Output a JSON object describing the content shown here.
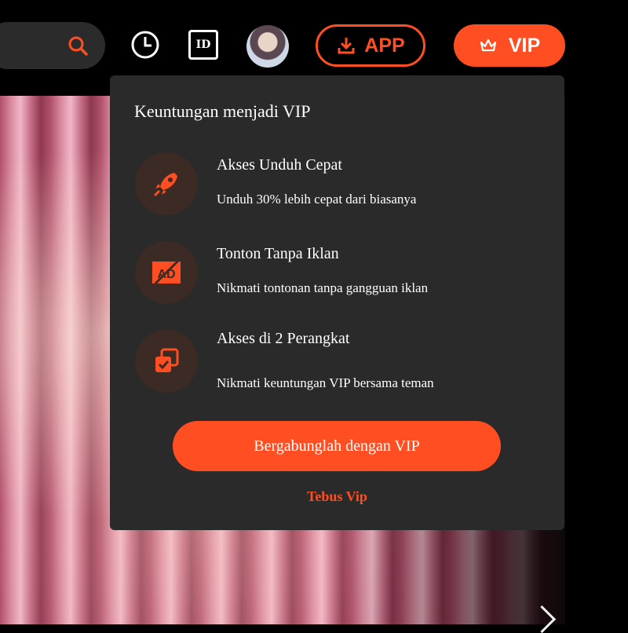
{
  "header": {
    "app_label": "APP",
    "vip_label": "VIP",
    "id_label": "ID",
    "icons": {
      "search": "search-icon",
      "history": "clock-icon",
      "id": "id-card-icon",
      "download": "download-icon",
      "crown": "crown-icon"
    }
  },
  "popup": {
    "title": "Keuntungan menjadi VIP",
    "benefits": [
      {
        "title": "Akses Unduh Cepat",
        "description": "Unduh 30% lebih cepat dari biasanya",
        "icon": "rocket-icon"
      },
      {
        "title": "Tonton Tanpa Iklan",
        "description": "Nikmati tontonan tanpa gangguan iklan",
        "icon": "no-ads-icon"
      },
      {
        "title": "Akses di 2 Perangkat",
        "description": "Nikmati keuntungan VIP bersama teman",
        "icon": "multi-device-icon"
      }
    ],
    "join_label": "Bergabunglah dengan VIP",
    "redeem_label": "Tebus Vip"
  },
  "colors": {
    "accent": "#ff4e21",
    "popup_bg": "#2a2a2a",
    "icon_circle_bg": "#3c2a24",
    "page_bg": "#000000"
  }
}
